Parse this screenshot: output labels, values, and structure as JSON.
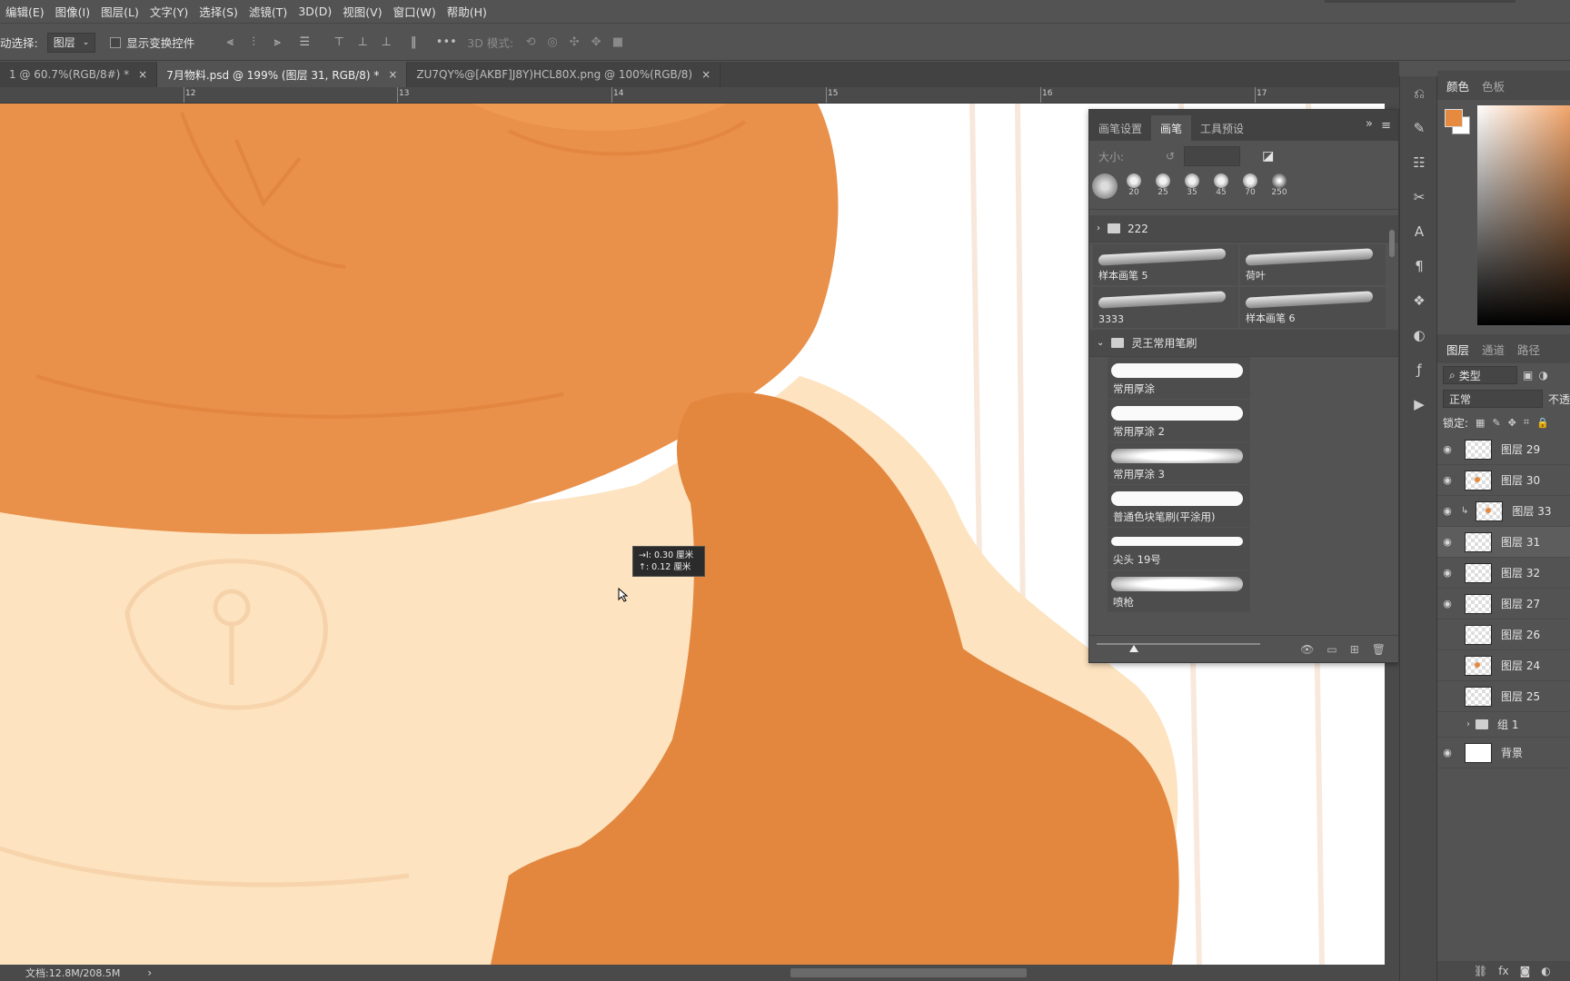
{
  "menu": [
    "编辑(E)",
    "图像(I)",
    "图层(L)",
    "文字(Y)",
    "选择(S)",
    "滤镜(T)",
    "3D(D)",
    "视图(V)",
    "窗口(W)",
    "帮助(H)"
  ],
  "options": {
    "auto_select_label": "动选择:",
    "auto_select_value": "图层",
    "show_transform_label": "显示变换控件",
    "mode_3d_label": "3D 模式:"
  },
  "tabs": [
    {
      "label": "1 @ 60.7%(RGB/8#) *",
      "close": "×",
      "active": false
    },
    {
      "label": "7月物料.psd @ 199% (图层 31, RGB/8) *",
      "close": "×",
      "active": true
    },
    {
      "label": "ZU7QY%@[AKBF]J8Y)HCL80X.png @ 100%(RGB/8)",
      "close": "×",
      "active": false
    }
  ],
  "ruler_labels": [
    "12",
    "13",
    "14",
    "15",
    "16",
    "17"
  ],
  "tooltip": {
    "line1": "→I: 0.30 厘米",
    "line2": "↑: 0.12 厘米"
  },
  "status": {
    "doc": "文档:12.8M/208.5M",
    "arrow": "›"
  },
  "brush_panel": {
    "tabs": [
      "画笔设置",
      "画笔",
      "工具预设"
    ],
    "active_tab": "画笔",
    "size_label": "大小:",
    "recent_sizes": [
      "",
      "20",
      "25",
      "35",
      "45",
      "70",
      "250"
    ],
    "group1": "222",
    "grid_brushes": [
      "样本画笔 5",
      "荷叶",
      "3333",
      "样本画笔 6"
    ],
    "group2": "灵王常用笔刷",
    "list_brushes": [
      "常用厚涂",
      "常用厚涂 2",
      "常用厚涂 3",
      "普通色块笔刷(平涂用)",
      "尖头 19号",
      "喷枪"
    ]
  },
  "right_panel": {
    "color_tabs": [
      "颜色",
      "色板"
    ],
    "fg_color": "#e58a3f",
    "layer_tabs": [
      "图层",
      "通道",
      "路径"
    ],
    "filter_label": "类型",
    "blend_mode": "正常",
    "opacity_label": "不透",
    "lock_label": "锁定:",
    "layers": [
      {
        "name": "图层 29",
        "visible": true,
        "selected": false,
        "clip": false
      },
      {
        "name": "图层 30",
        "visible": true,
        "selected": false,
        "clip": false
      },
      {
        "name": "图层 33",
        "visible": true,
        "selected": false,
        "clip": true
      },
      {
        "name": "图层 31",
        "visible": true,
        "selected": true,
        "clip": false
      },
      {
        "name": "图层 32",
        "visible": true,
        "selected": false,
        "clip": false
      },
      {
        "name": "图层 27",
        "visible": true,
        "selected": false,
        "clip": false
      },
      {
        "name": "图层 26",
        "visible": false,
        "selected": false,
        "clip": false
      },
      {
        "name": "图层 24",
        "visible": false,
        "selected": false,
        "clip": false
      },
      {
        "name": "图层 25",
        "visible": false,
        "selected": false,
        "clip": false
      }
    ],
    "group_layer": "组 1",
    "background_layer": "背景"
  },
  "colors": {
    "canvas_orange": "#e3873f",
    "canvas_light_orange": "#ef9a52",
    "canvas_cream": "#fde3bf",
    "canvas_white": "#ffffff"
  }
}
